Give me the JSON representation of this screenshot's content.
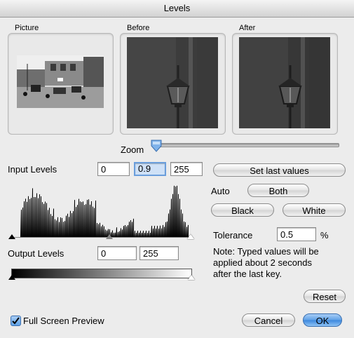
{
  "window": {
    "title": "Levels"
  },
  "panes": {
    "picture": "Picture",
    "before": "Before",
    "after": "After"
  },
  "zoom": {
    "label": "Zoom",
    "value": 0.0
  },
  "input_levels": {
    "label": "Input Levels",
    "black": "0",
    "gamma": "0.9",
    "white": "255"
  },
  "output_levels": {
    "label": "Output Levels",
    "black": "0",
    "white": "255"
  },
  "buttons": {
    "set_last": "Set last values",
    "both": "Both",
    "black": "Black",
    "white": "White",
    "reset": "Reset",
    "cancel": "Cancel",
    "ok": "OK"
  },
  "auto_label": "Auto",
  "tolerance": {
    "label": "Tolerance",
    "value": "0.5",
    "unit": "%"
  },
  "note": {
    "line1": "Note: Typed values will be",
    "line2": "applied about 2 seconds",
    "line3": "after the last key."
  },
  "full_screen": {
    "label": "Full Screen Preview",
    "checked": true
  },
  "colors": {
    "ok_button": "#3b87de",
    "focus_field": "#cfe1f7"
  }
}
